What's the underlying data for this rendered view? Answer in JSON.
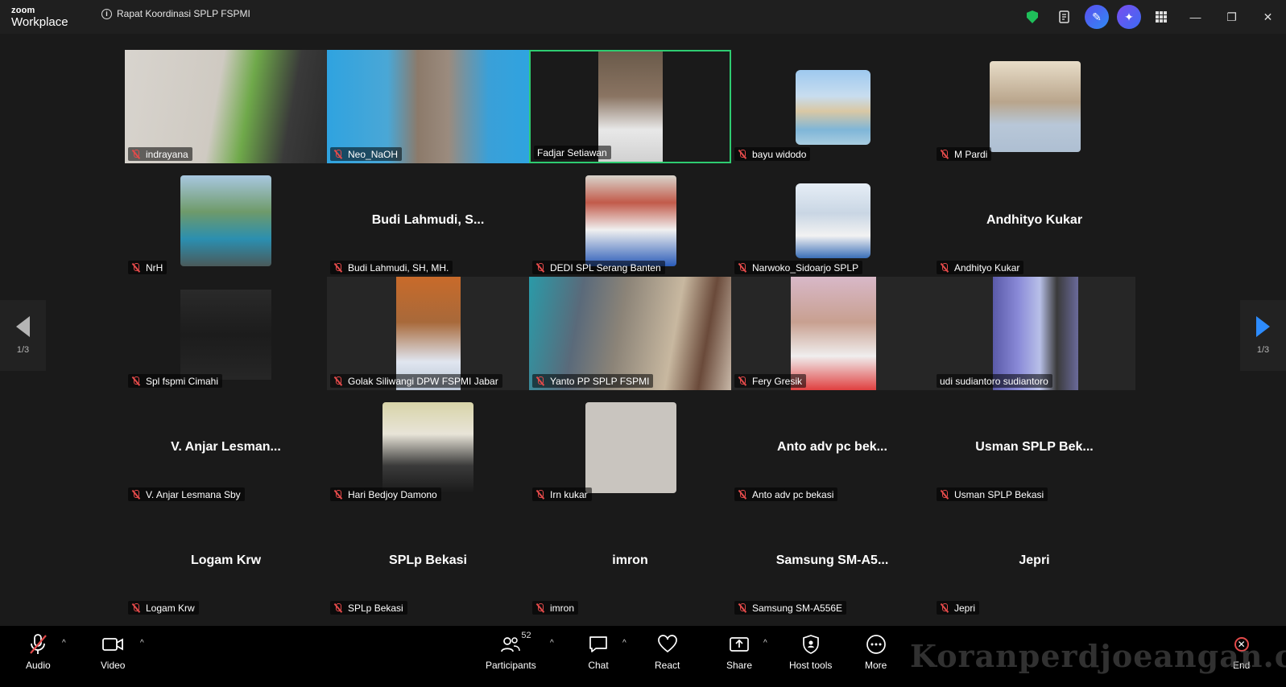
{
  "app": {
    "logo_top": "zoom",
    "logo_bottom": "Workplace",
    "meeting_title": "Rapat Koordinasi SPLP FSPMI"
  },
  "participants": [
    {
      "label": "indrayana",
      "center": ""
    },
    {
      "label": "Neo_NaOH",
      "center": ""
    },
    {
      "label": "Fadjar Setiawan",
      "center": ""
    },
    {
      "label": "bayu widodo",
      "center": ""
    },
    {
      "label": "M Pardi",
      "center": ""
    },
    {
      "label": "NrH",
      "center": ""
    },
    {
      "label": "Budi Lahmudi, SH, MH.",
      "center": "Budi Lahmudi, S..."
    },
    {
      "label": "DEDI SPL Serang Banten",
      "center": ""
    },
    {
      "label": "Narwoko_Sidoarjo SPLP",
      "center": ""
    },
    {
      "label": "Andhityo Kukar",
      "center": "Andhityo Kukar"
    },
    {
      "label": "Spl fspmi Cimahi",
      "center": ""
    },
    {
      "label": "Golak Siliwangi DPW FSPMI Jabar",
      "center": ""
    },
    {
      "label": "Yanto PP SPLP FSPMI",
      "center": ""
    },
    {
      "label": "Fery  Gresik",
      "center": ""
    },
    {
      "label": "udi sudiantoro sudiantoro",
      "center": ""
    },
    {
      "label": "V. Anjar Lesmana Sby",
      "center": "V. Anjar Lesman..."
    },
    {
      "label": "Hari Bedjoy Damono",
      "center": ""
    },
    {
      "label": "Irn  kukar",
      "center": ""
    },
    {
      "label": "Anto adv pc bekasi",
      "center": "Anto adv pc bek..."
    },
    {
      "label": "Usman SPLP Bekasi",
      "center": "Usman SPLP Bek..."
    },
    {
      "label": "Logam Krw",
      "center": "Logam Krw"
    },
    {
      "label": "SPLp Bekasi",
      "center": "SPLp Bekasi"
    },
    {
      "label": "imron",
      "center": "imron"
    },
    {
      "label": "Samsung SM-A556E",
      "center": "Samsung  SM-A5..."
    },
    {
      "label": "Jepri",
      "center": "Jepri"
    }
  ],
  "pager": {
    "left": "1/3",
    "right": "1/3"
  },
  "toolbar": {
    "audio": "Audio",
    "video": "Video",
    "participants": "Participants",
    "participant_count": "52",
    "chat": "Chat",
    "react": "React",
    "share": "Share",
    "host_tools": "Host tools",
    "more": "More",
    "end": "End"
  },
  "watermark": "Koranperdjoeangan.com",
  "colors": {
    "active_speaker": "#2ecc71",
    "muted": "#e34a4a",
    "accent": "#2d8cff",
    "shield": "#1fbf5a"
  }
}
